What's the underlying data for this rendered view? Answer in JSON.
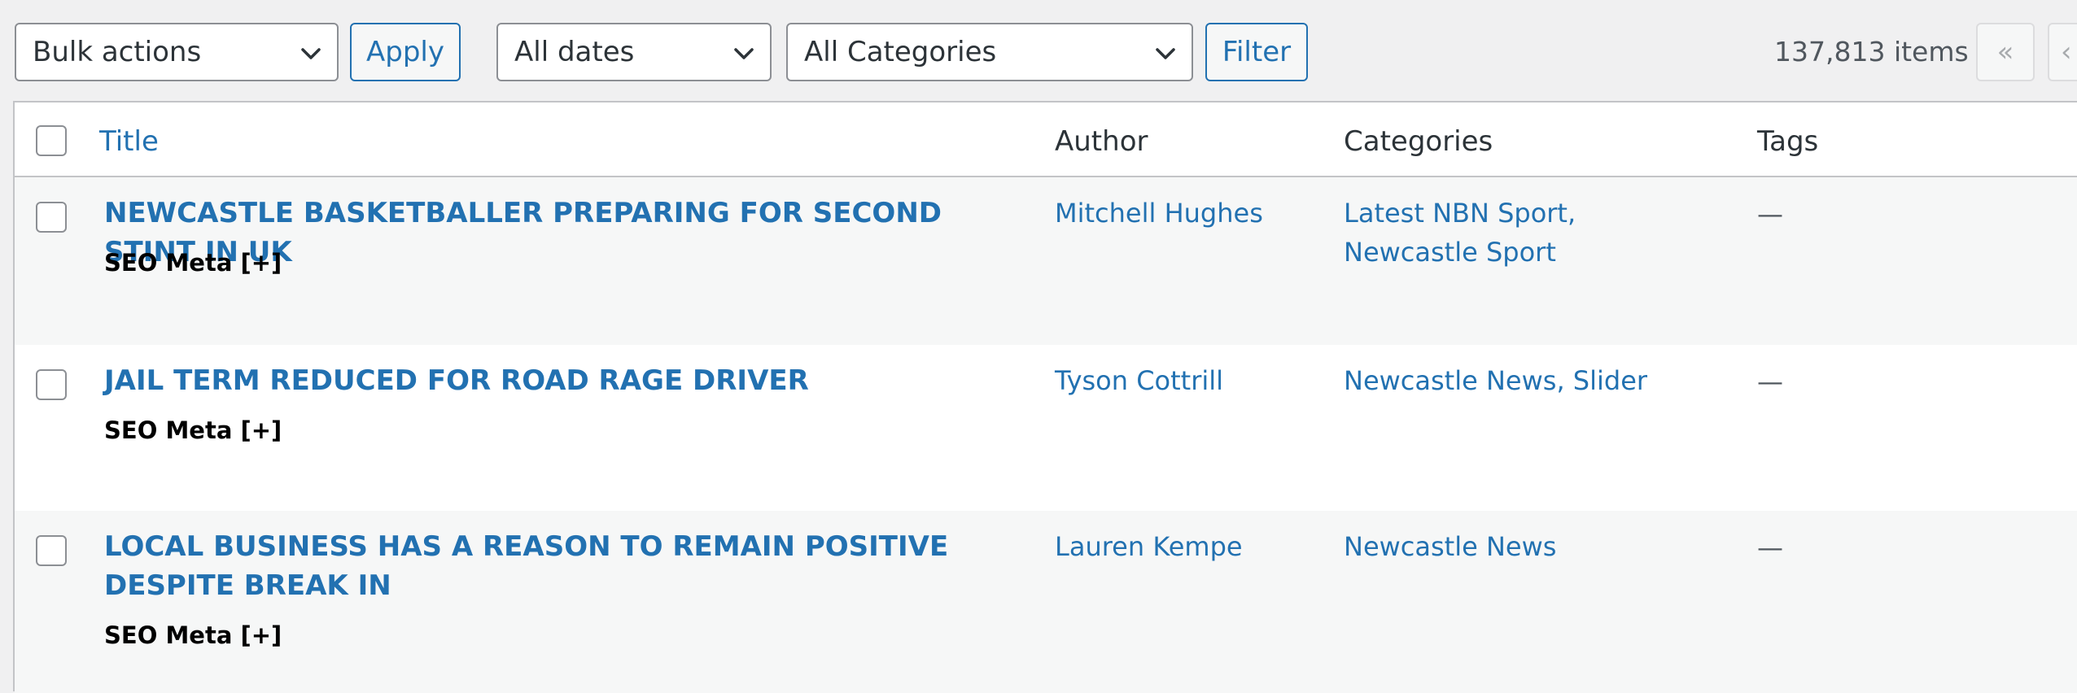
{
  "toolbar": {
    "bulk_actions_label": "Bulk actions",
    "apply_label": "Apply",
    "dates_label": "All dates",
    "categories_label": "All Categories",
    "filter_label": "Filter",
    "items_count": "137,813 items",
    "first_page_label": "«",
    "prev_page_label": "‹"
  },
  "table": {
    "headers": {
      "title": "Title",
      "author": "Author",
      "categories": "Categories",
      "tags": "Tags"
    },
    "rows": [
      {
        "title": "NEWCASTLE BASKETBALLER PREPARING FOR SECOND STINT IN UK",
        "seo_meta": "SEO Meta [+]",
        "author": "Mitchell Hughes",
        "categories": "Latest NBN Sport, Newcastle Sport",
        "tags": "—"
      },
      {
        "title": "JAIL TERM REDUCED FOR ROAD RAGE DRIVER",
        "seo_meta": "SEO Meta [+]",
        "author": "Tyson Cottrill",
        "categories": "Newcastle News, Slider",
        "tags": "—"
      },
      {
        "title": "LOCAL BUSINESS HAS A REASON TO REMAIN POSITIVE DESPITE BREAK IN",
        "seo_meta": "SEO Meta [+]",
        "author": "Lauren Kempe",
        "categories": "Newcastle News",
        "tags": "—"
      }
    ]
  },
  "colors": {
    "accent": "#2271b1",
    "border": "#c3c4c7",
    "background": "#f0f0f1",
    "row_alt": "#f6f7f7"
  }
}
